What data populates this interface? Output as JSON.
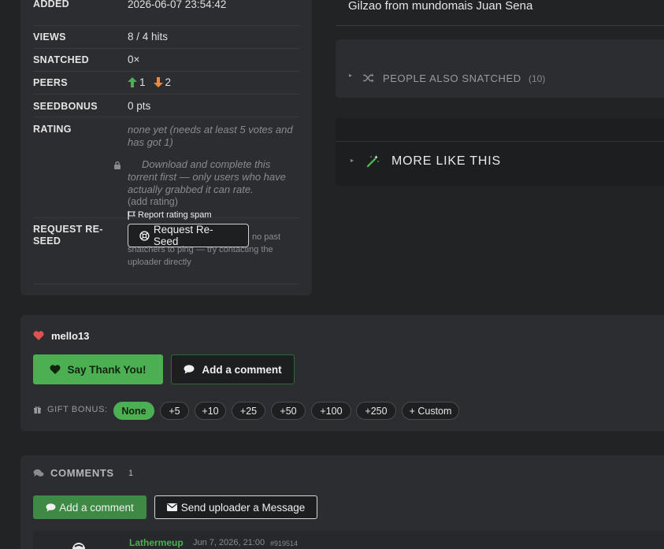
{
  "info": {
    "rows": [
      {
        "key": "ADDED",
        "value": "2026-06-07 23:54:42"
      },
      {
        "key": "VIEWS",
        "value": "8 / 4 hits"
      },
      {
        "key": "SNATCHED",
        "value": "0×"
      },
      {
        "key": "PEERS",
        "seeders": "1",
        "leechers": "2"
      },
      {
        "key": "SEEDBONUS",
        "value": "0 pts"
      },
      {
        "key": "RATING",
        "none_yet": "none yet (needs at least 5 votes and has got 1)",
        "locked_note": "Download and complete this torrent first — only users who have actually grabbed it can rate.",
        "add_rating": "(add rating)",
        "report_spam": "Report rating spam"
      },
      {
        "key": "REQUEST RE-SEED",
        "button": "Request Re-Seed",
        "note": "no past snatchers to ping — try contacting the uploader directly"
      }
    ]
  },
  "right": {
    "title_line": "Gilzao from mundomais Juan Sena",
    "also_snatched": {
      "label": "PEOPLE ALSO SNATCHED",
      "count": "(10)"
    },
    "more_like": {
      "label": "MORE LIKE THIS"
    }
  },
  "thanks": {
    "user": "mello13",
    "say_thanks": "Say Thank You!",
    "add_comment": "Add a comment",
    "gift_label": "GIFT BONUS:",
    "gift_options": [
      "None",
      "+5",
      "+10",
      "+25",
      "+50",
      "+100",
      "+250",
      "+ Custom"
    ],
    "gift_selected": "None"
  },
  "comments": {
    "title": "COMMENTS",
    "count": "1",
    "add_comment": "Add a comment",
    "send_message": "Send uploader a Message",
    "first": {
      "author": "Lathermeup",
      "date": "Jun 7, 2026, 21:00",
      "id": "#919514"
    }
  },
  "colors": {
    "green": "#4cb053",
    "orange": "#f0883e",
    "heart": "#e05252",
    "bg": "#222325",
    "panel": "#2c2d31"
  }
}
